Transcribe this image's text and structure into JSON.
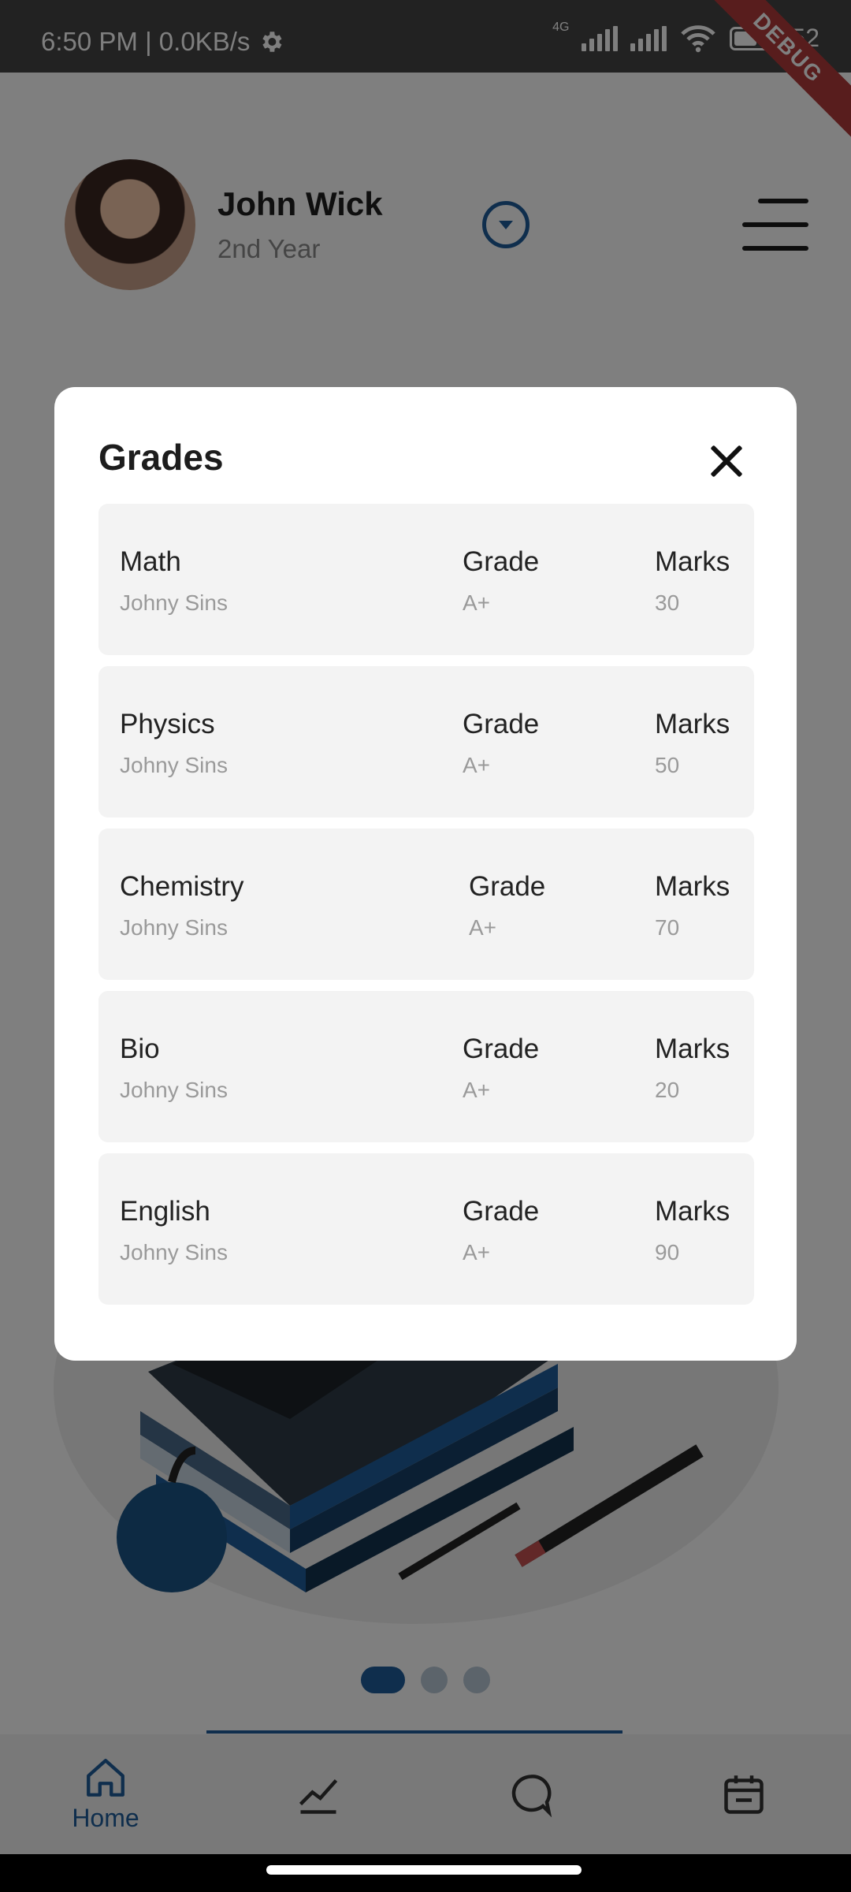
{
  "status_bar": {
    "time": "6:50 PM | 0.0KB/s",
    "network": "4G",
    "battery_percent": "52",
    "debug_banner": "DEBUG"
  },
  "profile": {
    "name": "John Wick",
    "year": "2nd Year"
  },
  "dialog": {
    "title": "Grades",
    "rows": [
      {
        "subject": "Math",
        "teacher": "Johny Sins",
        "grade_label": "Grade",
        "grade": "A+",
        "marks_label": "Marks",
        "marks": "30"
      },
      {
        "subject": "Physics",
        "teacher": "Johny Sins",
        "grade_label": "Grade",
        "grade": "A+",
        "marks_label": "Marks",
        "marks": "50"
      },
      {
        "subject": "Chemistry",
        "teacher": "Johny Sins",
        "grade_label": "Grade",
        "grade": "A+",
        "marks_label": "Marks",
        "marks": "70"
      },
      {
        "subject": "Bio",
        "teacher": "Johny Sins",
        "grade_label": "Grade",
        "grade": "A+",
        "marks_label": "Marks",
        "marks": "20"
      },
      {
        "subject": "English",
        "teacher": "Johny Sins",
        "grade_label": "Grade",
        "grade": "A+",
        "marks_label": "Marks",
        "marks": "90"
      }
    ]
  },
  "bottom_nav": {
    "items": [
      {
        "label": "Home",
        "icon": "home-icon",
        "active": true
      },
      {
        "label": "",
        "icon": "chart-icon",
        "active": false
      },
      {
        "label": "",
        "icon": "chat-icon",
        "active": false
      },
      {
        "label": "",
        "icon": "calendar-icon",
        "active": false
      }
    ]
  },
  "carousel": {
    "pages": 3,
    "active_index": 0
  },
  "colors": {
    "accent": "#1f5d9a",
    "status_bar": "#444444",
    "card_bg": "#f3f3f3",
    "scrim": "rgba(0,0,0,0.5)"
  }
}
